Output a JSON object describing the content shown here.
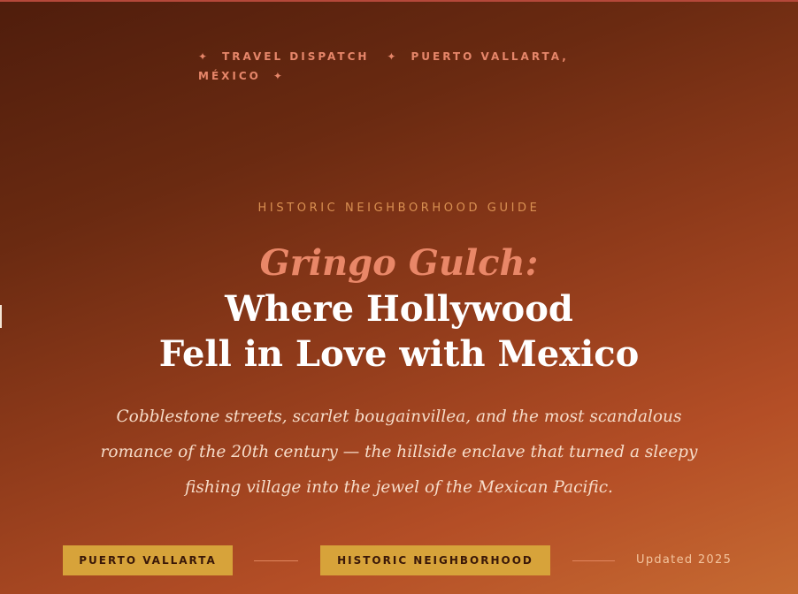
{
  "dispatch": {
    "label": "TRAVEL DISPATCH",
    "location_line1": "PUERTO VALLARTA,",
    "location_line2": "MÉXICO",
    "separator": "✦"
  },
  "hero": {
    "kicker": "HISTORIC NEIGHBORHOOD GUIDE",
    "title_accent": "Gringo Gulch:",
    "title_line1": "Where Hollywood",
    "title_line2": "Fell in Love with Mexico",
    "dek": "Cobblestone streets, scarlet bougainvillea, and the most scandalous romance of the 20th century — the hillside enclave that turned a sleepy fishing village into the jewel of the Mexican Pacific."
  },
  "tags": [
    {
      "label": "PUERTO VALLARTA"
    },
    {
      "label": "HISTORIC NEIGHBORHOOD"
    }
  ],
  "meta": {
    "updated": "Updated 2025"
  },
  "colors": {
    "background_dark": "#4f1d0c",
    "background_light": "#c66a32",
    "accent_coral": "#e98768",
    "tag_gold": "#d7a33a",
    "kicker_gold": "#d99052"
  }
}
